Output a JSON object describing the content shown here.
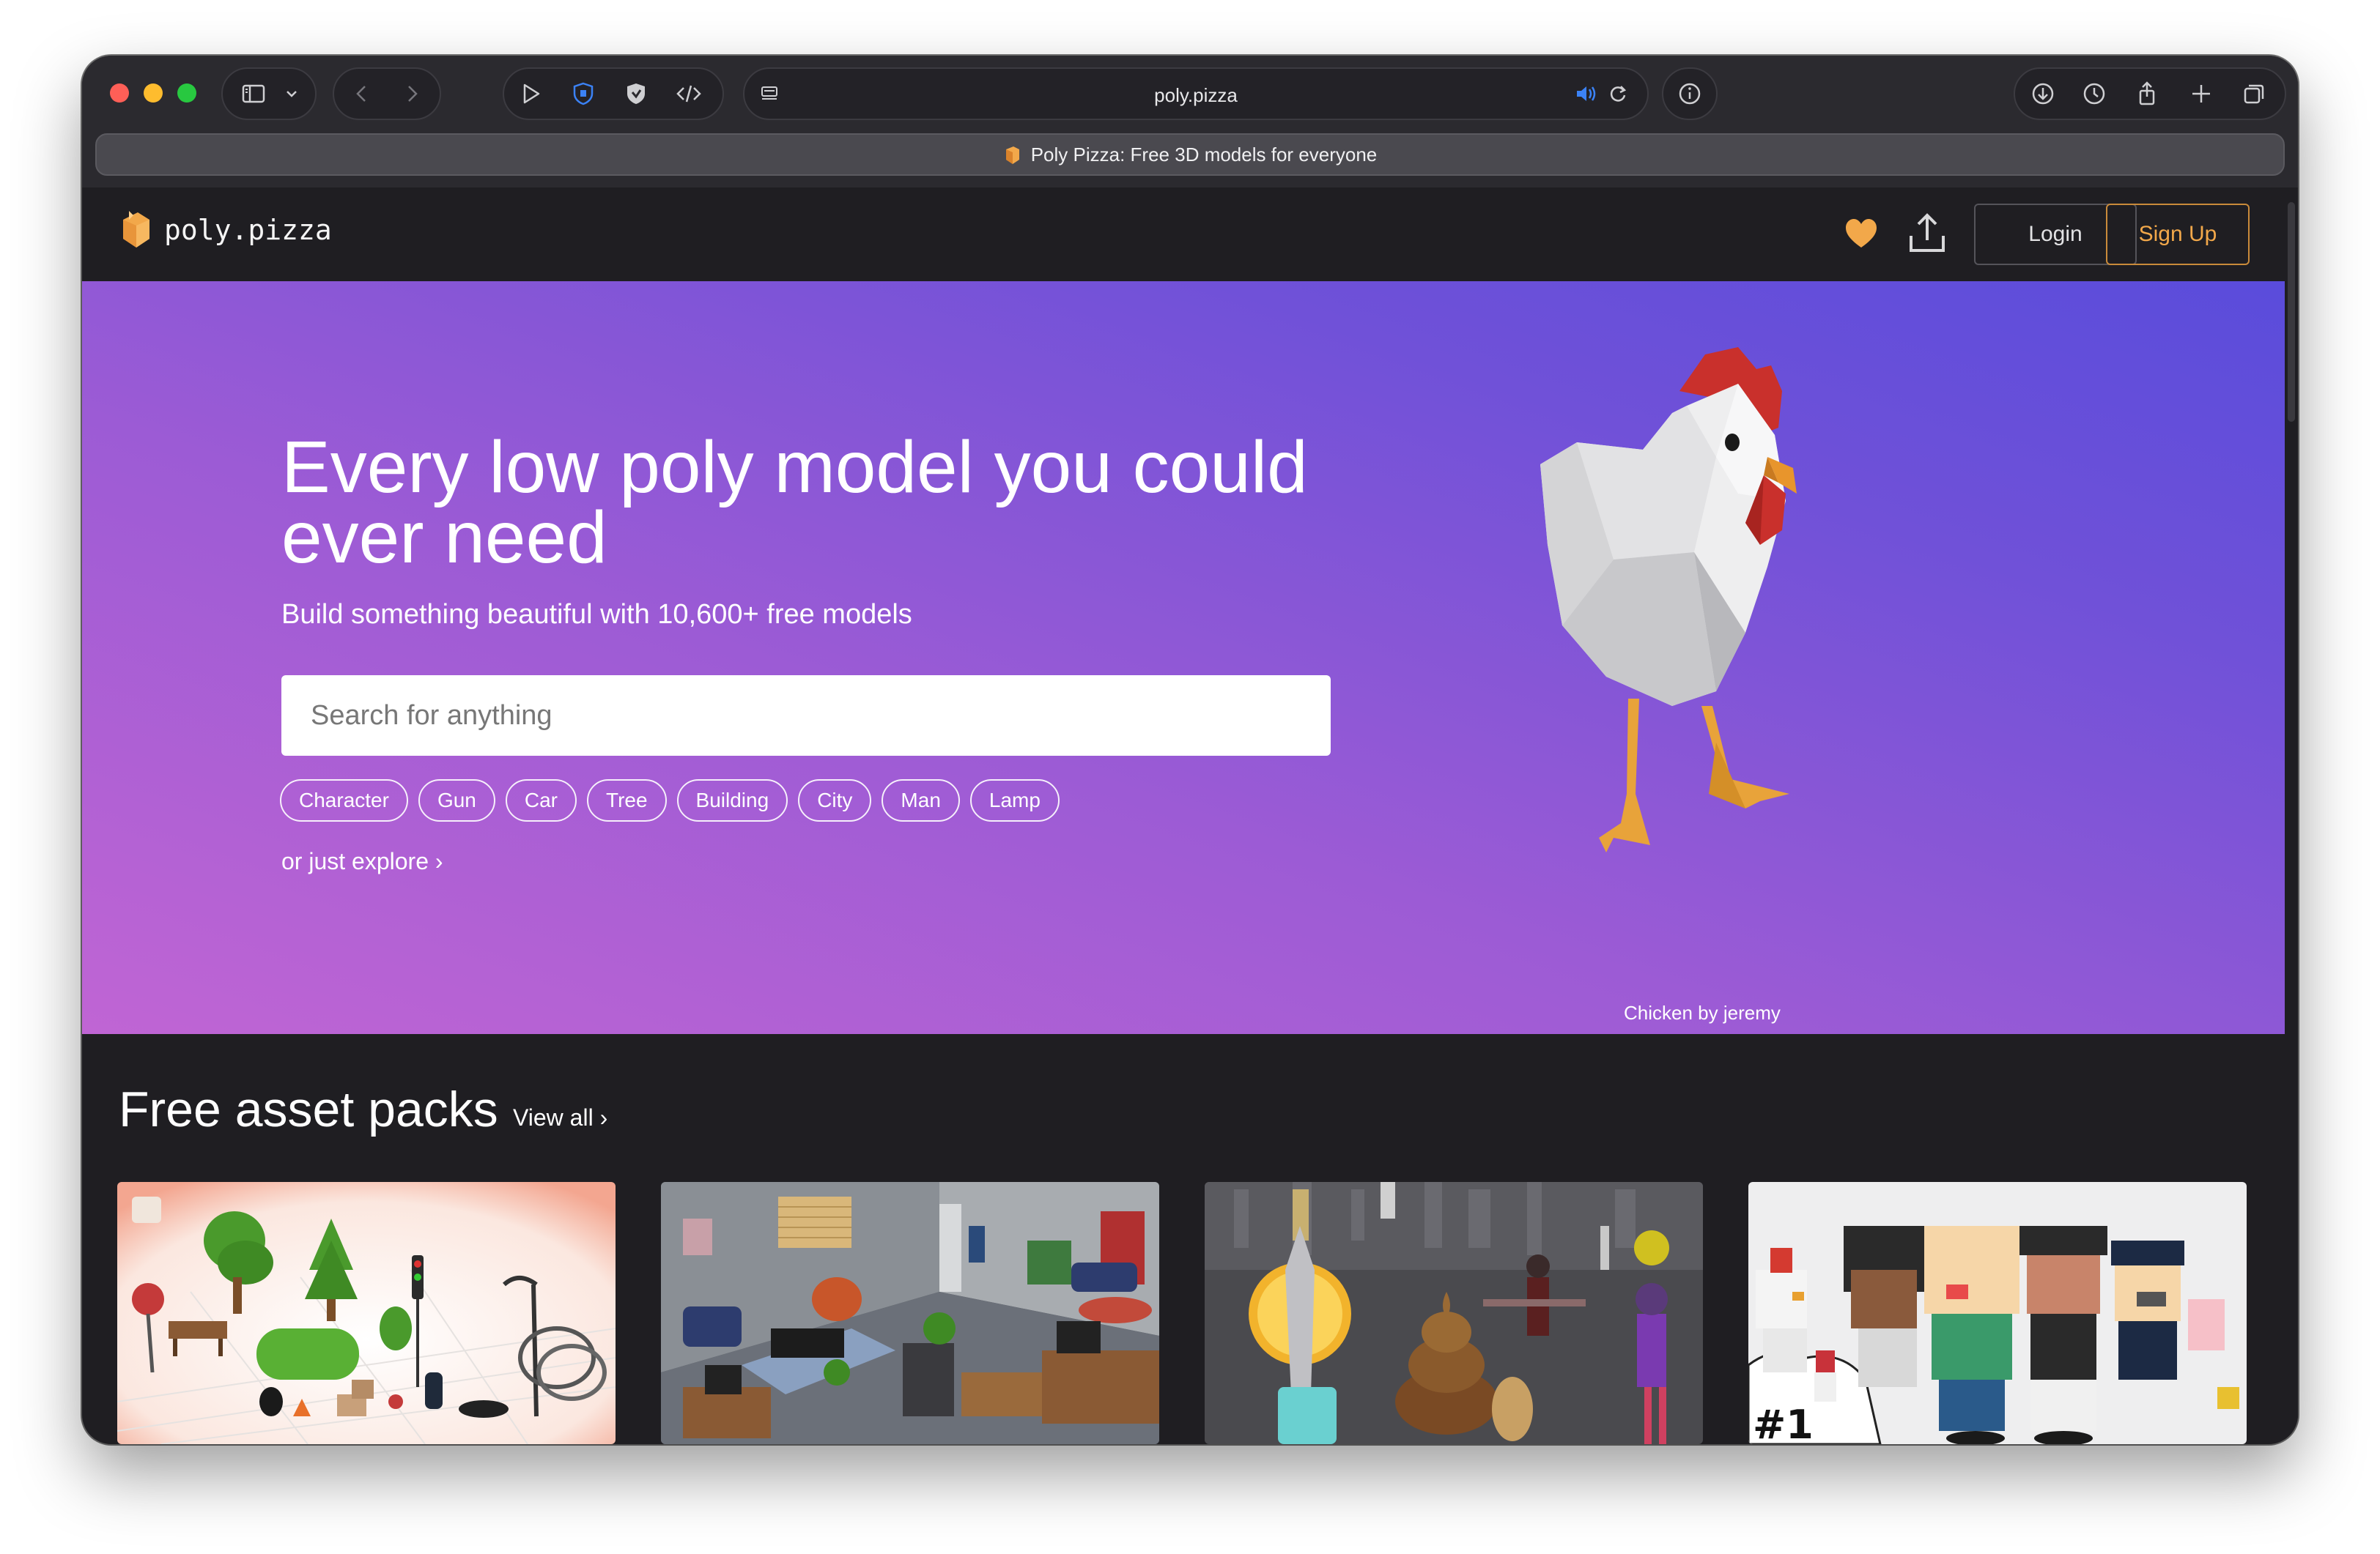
{
  "browser": {
    "url": "poly.pizza",
    "tab_title": "Poly Pizza: Free 3D models for everyone"
  },
  "header": {
    "logo_text": "poly.pizza",
    "login_label": "Login",
    "signup_label": "Sign Up"
  },
  "hero": {
    "title": "Every low poly model you could ever need",
    "subtitle": "Build something beautiful with 10,600+ free models",
    "search_placeholder": "Search for anything",
    "chips": [
      "Character",
      "Gun",
      "Car",
      "Tree",
      "Building",
      "City",
      "Man",
      "Lamp"
    ],
    "explore_label": "or just explore ›",
    "credit": "Chicken by jeremy"
  },
  "packs": {
    "title": "Free asset packs",
    "view_all_label": "View all ›"
  },
  "colors": {
    "brand_orange": "#f2a84a",
    "hero_gradient_start": "#c065d4",
    "hero_gradient_end": "#5a4cdb",
    "page_bg": "#1f1e22"
  }
}
